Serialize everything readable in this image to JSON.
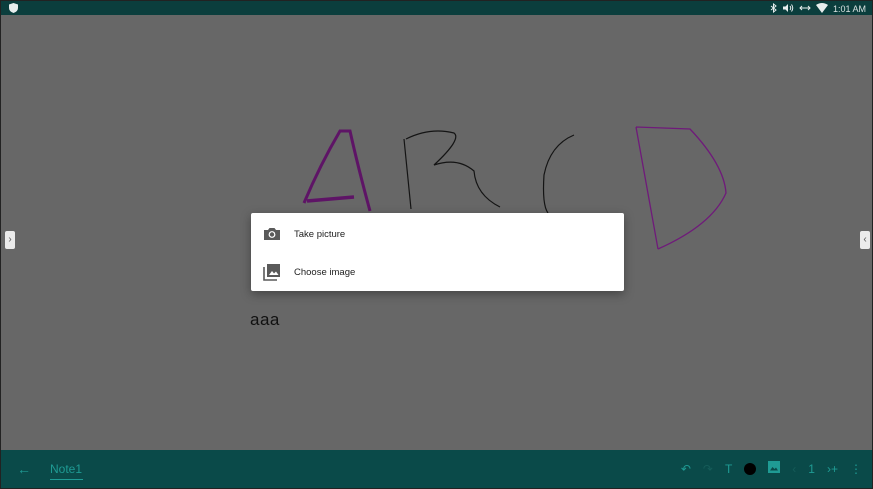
{
  "status_bar": {
    "time": "1:01 AM",
    "icons": [
      "shield-icon",
      "bluetooth-icon",
      "volume-icon",
      "data-sync-icon",
      "wifi-icon"
    ]
  },
  "canvas": {
    "text_box": "aaa",
    "drawing_colors": {
      "purple": "#6f1a7a",
      "black": "#111111"
    }
  },
  "image_menu": {
    "items": [
      {
        "label": "Take picture",
        "icon": "camera-icon"
      },
      {
        "label": "Choose image",
        "icon": "image-gallery-icon"
      }
    ]
  },
  "edge_handles": {
    "left": "›",
    "right": "‹"
  },
  "bottom_bar": {
    "back_icon": "←",
    "note_title": "Note1",
    "tools": {
      "undo": "↶",
      "redo": "↷",
      "text": "T",
      "color": "#000000",
      "insert_image": "image-icon",
      "prev_page": "‹",
      "page_number": "1",
      "next_page_add": "›+",
      "menu": "⋮"
    }
  },
  "colors": {
    "status_bar": "#0b3e3d",
    "bottom_bar": "#0a4a49",
    "accent": "#1f9b94",
    "dim_overlay_canvas": "#676767"
  }
}
